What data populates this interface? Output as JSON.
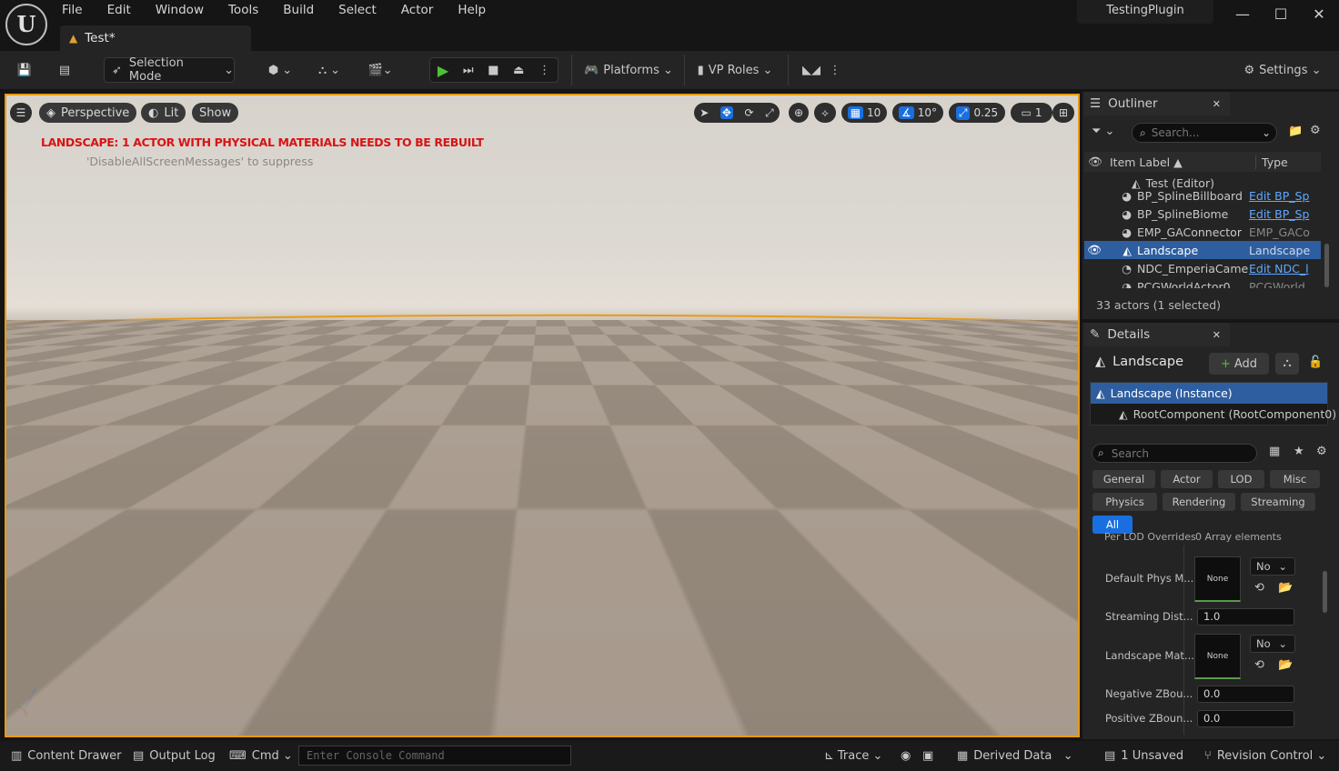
{
  "menu": [
    "File",
    "Edit",
    "Window",
    "Tools",
    "Build",
    "Select",
    "Actor",
    "Help"
  ],
  "tab": {
    "label": "Test*"
  },
  "project": "TestingPlugin",
  "toolbar": {
    "selection_mode": "Selection Mode",
    "platforms": "Platforms",
    "vp_roles": "VP Roles",
    "settings": "Settings"
  },
  "viewport": {
    "perspective": "Perspective",
    "lit": "Lit",
    "show": "Show",
    "grid_snap": "10",
    "rot_snap": "10°",
    "scale_snap": "0.25",
    "camera_speed": "1",
    "warning": "LANDSCAPE: 1 ACTOR WITH PHYSICAL MATERIALS NEEDS TO BE REBUILT",
    "suppress": "'DisableAllScreenMessages' to suppress"
  },
  "outliner": {
    "title": "Outliner",
    "search_placeholder": "Search...",
    "col_label": "Item Label ▲",
    "col_type": "Type",
    "world": "Test (Editor)",
    "rows": [
      {
        "label": "BP_SplineBillboard",
        "type": "Edit BP_Sp",
        "link": true
      },
      {
        "label": "BP_SplineBiome",
        "type": "Edit BP_Sp",
        "link": true
      },
      {
        "label": "EMP_GAConnector",
        "type": "EMP_GACo",
        "link": false
      },
      {
        "label": "Landscape",
        "type": "Landscape",
        "link": false
      },
      {
        "label": "NDC_EmperiaCame",
        "type": "Edit NDC_l",
        "link": true
      },
      {
        "label": "PCGWorldActor0",
        "type": "PCGWorld",
        "link": false
      }
    ],
    "count": "33 actors (1 selected)"
  },
  "details": {
    "title": "Details",
    "actor": "Landscape",
    "add": "Add",
    "instance": "Landscape (Instance)",
    "root": "RootComponent (RootComponent0)",
    "search_placeholder": "Search",
    "cats": [
      "General",
      "Actor",
      "LOD",
      "Misc",
      "Physics",
      "Rendering",
      "Streaming",
      "All"
    ],
    "props": {
      "cut": "Per LOD Overrides",
      "cut_val": "0 Array elements",
      "phys_label": "Default Phys M...",
      "phys_thumb": "None",
      "phys_dd": "No",
      "stream_label": "Streaming Dist...",
      "stream_val": "1.0",
      "mat_label": "Landscape Mat...",
      "mat_thumb": "None",
      "mat_dd": "No",
      "negz_label": "Negative ZBou...",
      "negz_val": "0.0",
      "posz_label": "Positive ZBoun...",
      "posz_val": "0.0"
    }
  },
  "status": {
    "content_drawer": "Content Drawer",
    "output_log": "Output Log",
    "cmd": "Cmd",
    "console_placeholder": "Enter Console Command",
    "trace": "Trace",
    "derived_data": "Derived Data",
    "unsaved": "1 Unsaved",
    "revision": "Revision Control"
  }
}
